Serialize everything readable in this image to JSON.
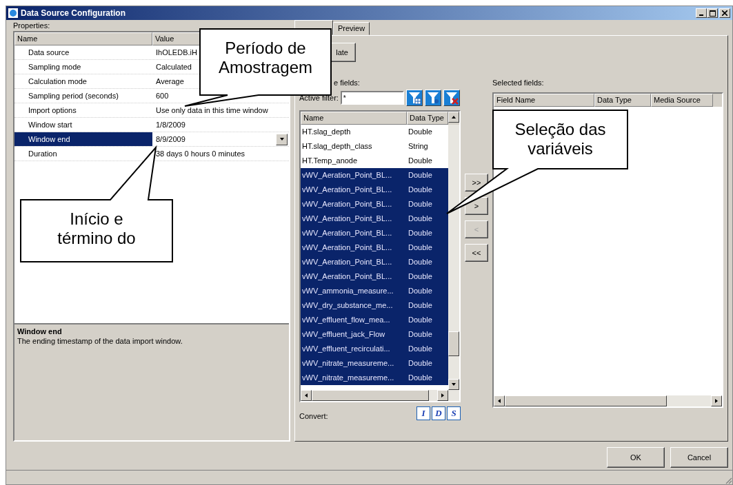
{
  "window": {
    "title": "Data Source Configuration"
  },
  "properties": {
    "label": "Properties:",
    "columns": [
      "Name",
      "Value"
    ],
    "rows": [
      {
        "name": "Data source",
        "value": "IhOLEDB.iH",
        "selected": false
      },
      {
        "name": "Sampling mode",
        "value": "Calculated",
        "selected": false
      },
      {
        "name": "Calculation mode",
        "value": "Average",
        "selected": false
      },
      {
        "name": "Sampling period (seconds)",
        "value": "600",
        "selected": false
      },
      {
        "name": "Import options",
        "value": "Use only data in this time window",
        "selected": false
      },
      {
        "name": "Window start",
        "value": "1/8/2009",
        "selected": false
      },
      {
        "name": "Window end",
        "value": "8/9/2009",
        "selected": true,
        "dropdown": true
      },
      {
        "name": "Duration",
        "value": "38 days 0 hours 0 minutes",
        "selected": false
      }
    ],
    "description": {
      "title": "Window end",
      "text": "The ending timestamp of the data import window."
    }
  },
  "tabs": [
    {
      "selected": true
    },
    {
      "label": "Preview",
      "selected": false
    }
  ],
  "update_button": "late",
  "available": {
    "label": "e fields:",
    "filter_label": "Active filter:",
    "filter_value": "*",
    "columns": [
      "Name",
      "Data Type"
    ],
    "rows": [
      {
        "name": "HT.slag_depth",
        "type": "Double",
        "selected": false
      },
      {
        "name": "HT.slag_depth_class",
        "type": "String",
        "selected": false
      },
      {
        "name": "HT.Temp_anode",
        "type": "Double",
        "selected": false
      },
      {
        "name": "vWV_Aeration_Point_BL...",
        "type": "Double",
        "selected": true
      },
      {
        "name": "vWV_Aeration_Point_BL...",
        "type": "Double",
        "selected": true
      },
      {
        "name": "vWV_Aeration_Point_BL...",
        "type": "Double",
        "selected": true
      },
      {
        "name": "vWV_Aeration_Point_BL...",
        "type": "Double",
        "selected": true
      },
      {
        "name": "vWV_Aeration_Point_BL...",
        "type": "Double",
        "selected": true
      },
      {
        "name": "vWV_Aeration_Point_BL...",
        "type": "Double",
        "selected": true
      },
      {
        "name": "vWV_Aeration_Point_BL...",
        "type": "Double",
        "selected": true
      },
      {
        "name": "vWV_Aeration_Point_BL...",
        "type": "Double",
        "selected": true
      },
      {
        "name": "vWV_ammonia_measure...",
        "type": "Double",
        "selected": true
      },
      {
        "name": "vWV_dry_substance_me...",
        "type": "Double",
        "selected": true
      },
      {
        "name": "vWV_effluent_flow_mea...",
        "type": "Double",
        "selected": true
      },
      {
        "name": "vWV_effluent_jack_Flow",
        "type": "Double",
        "selected": true
      },
      {
        "name": "vWV_effluent_recirculati...",
        "type": "Double",
        "selected": true
      },
      {
        "name": "vWV_nitrate_measureme...",
        "type": "Double",
        "selected": true
      },
      {
        "name": "vWV_nitrate_measureme...",
        "type": "Double",
        "selected": true
      }
    ],
    "convert_label": "Convert:",
    "convert_buttons": [
      "I",
      "D",
      "S"
    ]
  },
  "move_buttons": [
    {
      "label": ">>",
      "disabled": false
    },
    {
      "label": ">",
      "disabled": false
    },
    {
      "label": "<",
      "disabled": true
    },
    {
      "label": "<<",
      "disabled": false
    }
  ],
  "selected_fields": {
    "label": "Selected fields:",
    "columns": [
      "Field Name",
      "Data Type",
      "Media Source"
    ]
  },
  "buttons": [
    "OK",
    "Cancel"
  ],
  "callouts": [
    {
      "kind": "period",
      "lines": [
        "Período de",
        "Amostragem"
      ]
    },
    {
      "kind": "selection",
      "lines": [
        "Seleção das",
        "variáveis"
      ]
    },
    {
      "kind": "window",
      "lines": [
        "Início e",
        "término do"
      ]
    }
  ]
}
